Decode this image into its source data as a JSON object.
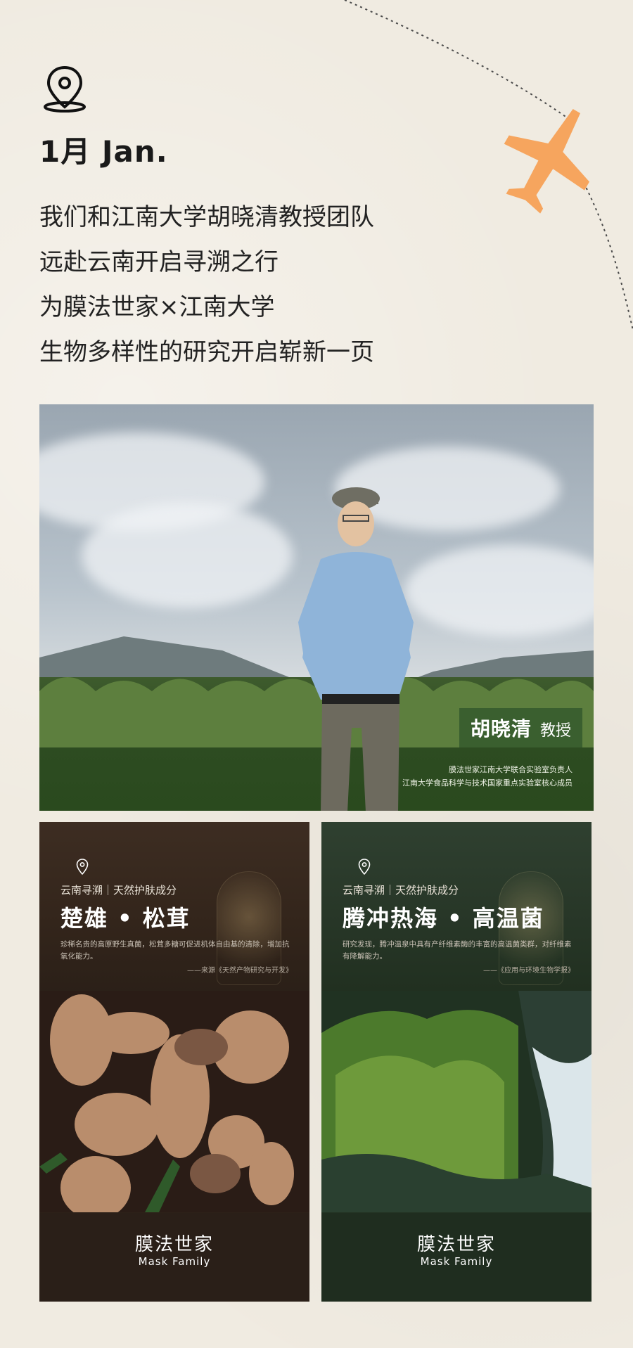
{
  "header": {
    "month": "1月 Jan.",
    "intro_lines": [
      "我们和江南大学胡晓清教授团队",
      "远赴云南开启寻溯之行",
      "为膜法世家×江南大学",
      "生物多样性的研究开启崭新一页"
    ]
  },
  "hero": {
    "name": "胡晓清",
    "title": "教授",
    "notes": [
      "膜法世家江南大学联合实验室负责人",
      "江南大学食品科学与技术国家重点实验室核心成员"
    ]
  },
  "cards": [
    {
      "kicker": "云南寻溯｜天然护肤成分",
      "title": "楚雄 • 松茸",
      "desc": "珍稀名贵的高原野生真菌，松茸多糖可促进机体自由基的清除，增加抗氧化能力。",
      "source": "——来源《天然产物研究与开发》",
      "brand_cn": "膜法世家",
      "brand_en": "Mask Family"
    },
    {
      "kicker": "云南寻溯｜天然护肤成分",
      "title": "腾冲热海 • 高温菌",
      "desc": "研究发现，腾冲温泉中具有产纤维素酶的丰富的高温菌类群，对纤维素有降解能力。",
      "source": "——《应用与环境生物学报》",
      "brand_cn": "膜法世家",
      "brand_en": "Mask Family"
    }
  ],
  "colors": {
    "background": "#f0ebe1",
    "plane": "#f6a55e",
    "card_left": "#2c2119",
    "card_right": "#233222"
  },
  "icons": [
    "location-pin-icon",
    "airplane-icon"
  ]
}
